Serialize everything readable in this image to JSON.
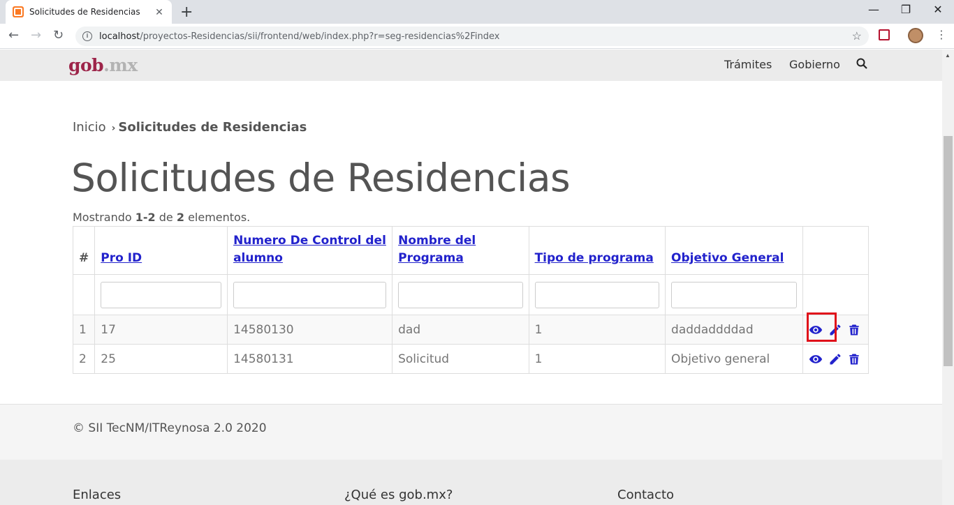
{
  "browser": {
    "tab_title": "Solicitudes de Residencias",
    "tab_close": "✕",
    "new_tab": "+",
    "url_host": "localhost",
    "url_path": "/proyectos-Residencias/sii/frontend/web/index.php?r=seg-residencias%2Findex",
    "minimize": "—",
    "maximize": "❐",
    "close": "✕"
  },
  "header": {
    "logo_main": "gob",
    "logo_suffix": ".mx",
    "nav": [
      "Trámites",
      "Gobierno"
    ]
  },
  "breadcrumb": {
    "home": "Inicio",
    "current": "Solicitudes de Residencias"
  },
  "page": {
    "title": "Solicitudes de Residencias",
    "summary_prefix": "Mostrando ",
    "summary_range": "1-2",
    "summary_mid": " de ",
    "summary_total": "2",
    "summary_suffix": " elementos."
  },
  "table": {
    "headers": [
      "#",
      "Pro ID",
      "Numero De Control del alumno",
      "Nombre del Programa",
      "Tipo de programa",
      "Objetivo General"
    ],
    "rows": [
      {
        "num": "1",
        "pro_id": "17",
        "control": "14580130",
        "nombre": "dad",
        "tipo": "1",
        "objetivo": "daddaddddad"
      },
      {
        "num": "2",
        "pro_id": "25",
        "control": "14580131",
        "nombre": "Solicitud",
        "tipo": "1",
        "objetivo": "Objetivo general"
      }
    ]
  },
  "colors": {
    "accent": "#9d2449",
    "link": "#2222cc",
    "highlight": "#e0101a"
  },
  "footer": {
    "copyright": "© SII TecNM/ITReynosa 2.0 2020",
    "col1": "Enlaces",
    "col2": "¿Qué es gob.mx?",
    "col3": "Contacto"
  }
}
